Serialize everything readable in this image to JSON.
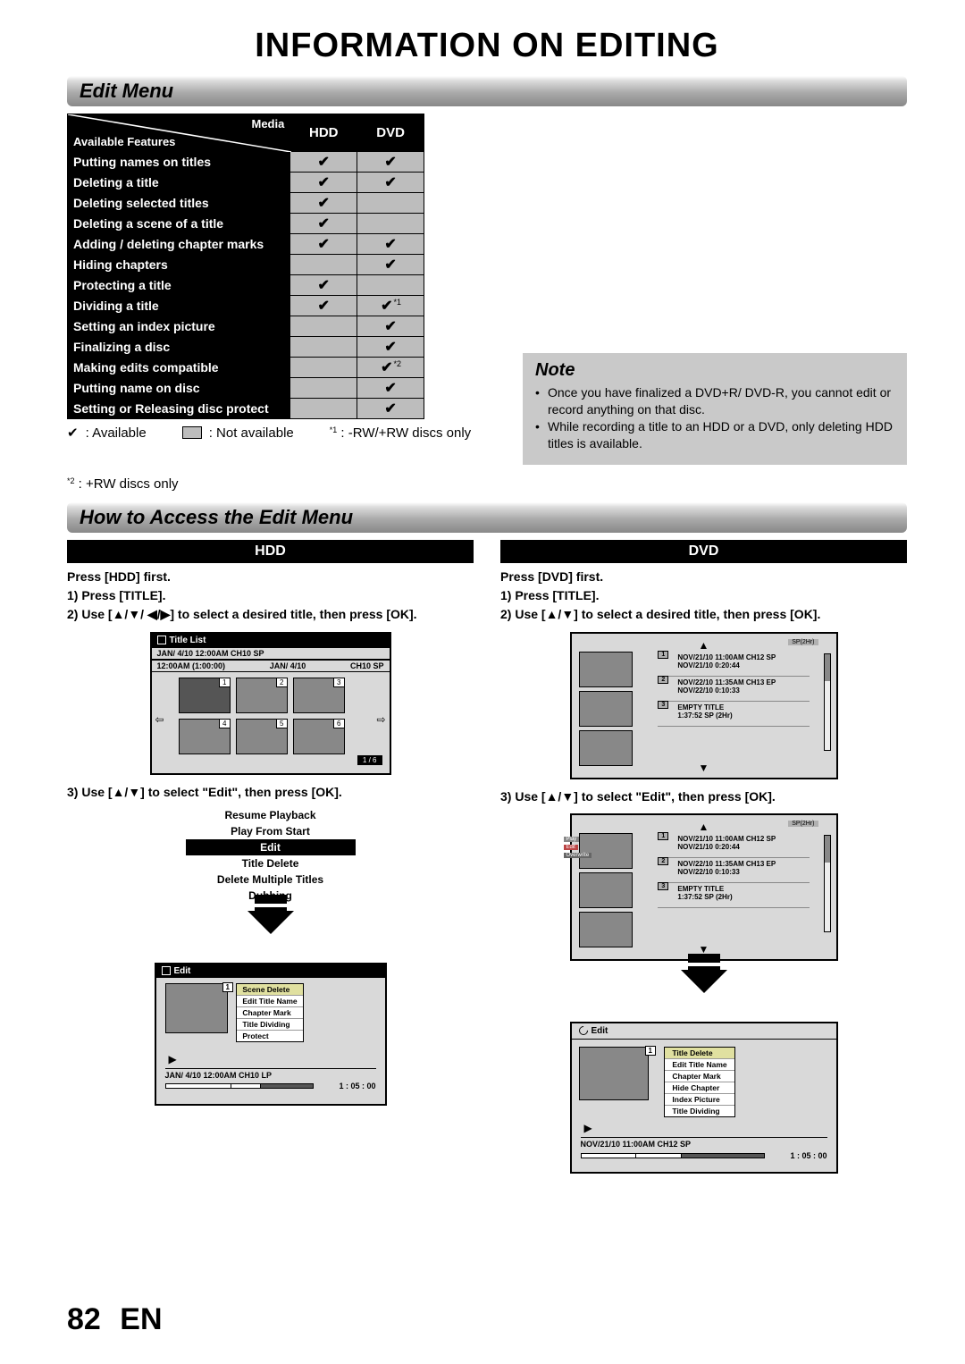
{
  "page": {
    "title": "INFORMATION ON EDITING",
    "number": "82",
    "lang": "EN"
  },
  "sections": {
    "edit_menu": "Edit Menu",
    "how_to": "How to Access the Edit Menu"
  },
  "features_table": {
    "corner_media": "Media",
    "corner_avail": "Available Features",
    "cols": [
      "HDD",
      "DVD"
    ],
    "rows": [
      {
        "label": "Putting names on titles",
        "hdd": "✔",
        "dvd": "✔"
      },
      {
        "label": "Deleting a title",
        "hdd": "✔",
        "dvd": "✔"
      },
      {
        "label": "Deleting selected titles",
        "hdd": "✔",
        "dvd": ""
      },
      {
        "label": "Deleting a scene of a title",
        "hdd": "✔",
        "dvd": ""
      },
      {
        "label": "Adding / deleting chapter marks",
        "hdd": "✔",
        "dvd": "✔"
      },
      {
        "label": "Hiding chapters",
        "hdd": "",
        "dvd": "✔"
      },
      {
        "label": "Protecting a title",
        "hdd": "✔",
        "dvd": ""
      },
      {
        "label": "Dividing a title",
        "hdd": "✔",
        "dvd": "✔",
        "dvd_sup": "*1"
      },
      {
        "label": "Setting an index picture",
        "hdd": "",
        "dvd": "✔"
      },
      {
        "label": "Finalizing a disc",
        "hdd": "",
        "dvd": "✔"
      },
      {
        "label": "Making edits compatible",
        "hdd": "",
        "dvd": "✔",
        "dvd_sup": "*2"
      },
      {
        "label": "Putting name on disc",
        "hdd": "",
        "dvd": "✔"
      },
      {
        "label": "Setting or Releasing disc protect",
        "hdd": "",
        "dvd": "✔"
      }
    ]
  },
  "legend": {
    "available": "✔",
    "available_label": ": Available",
    "na_label": ": Not available",
    "foot1_sup": "*1",
    "foot1": " : -RW/+RW discs only",
    "foot2_sup": "*2",
    "foot2": " : +RW discs only"
  },
  "note": {
    "title": "Note",
    "items": [
      "Once you have finalized a DVD+R/ DVD-R, you cannot edit or record anything on that disc.",
      "While recording a title to an HDD or a DVD, only deleting HDD titles is available."
    ]
  },
  "hdd": {
    "head": "HDD",
    "press_first": "Press [HDD] first.",
    "s1": "1) Press [TITLE].",
    "s2": "2) Use [▲/▼/ ◀/▶] to select a desired title, then press [OK].",
    "s3": "3) Use [▲/▼] to select \"Edit\", then press [OK].",
    "title_list": {
      "header": "Title List",
      "line1_left": "JAN/ 4/10 12:00AM CH10 SP",
      "line2_left": "12:00AM (1:00:00)",
      "line2_mid": "JAN/ 4/10",
      "line2_right": "CH10  SP",
      "pager": "1 / 6",
      "thumbs": [
        "1",
        "2",
        "3",
        "4",
        "5",
        "6"
      ]
    },
    "popup": {
      "items": [
        "Resume Playback",
        "Play From Start",
        "Edit",
        "Title Delete",
        "Delete Multiple Titles",
        "Dubbing"
      ],
      "selected": 2
    },
    "edit_screen": {
      "header": "Edit",
      "num": "1",
      "opts": [
        "Scene Delete",
        "Edit Title Name",
        "Chapter Mark",
        "Title Dividing",
        "Protect"
      ],
      "info": "JAN/ 4/10 12:00AM CH10  LP",
      "time": "1 : 05 : 00"
    }
  },
  "dvd": {
    "head": "DVD",
    "press_first": "Press [DVD] first.",
    "s1": "1) Press [TITLE].",
    "s2": "2) Use [▲/▼] to select a desired title, then press [OK].",
    "s3": "3) Use [▲/▼] to select \"Edit\", then press [OK].",
    "list_screen": {
      "sp": "SP(2Hr)",
      "slots": [
        {
          "n": "1",
          "l1": "NOV/21/10  11:00AM CH12 SP",
          "l2": "NOV/21/10  0:20:44"
        },
        {
          "n": "2",
          "l1": "NOV/22/10  11:35AM CH13 EP",
          "l2": "NOV/22/10  0:10:33"
        },
        {
          "n": "3",
          "l1": "EMPTY TITLE",
          "l2": "1:37:52 SP (2Hr)"
        }
      ]
    },
    "list_screen2": {
      "sp": "SP(2Hr)",
      "tags": [
        "Play",
        "Edit",
        "Overwrite"
      ],
      "slots": [
        {
          "n": "1",
          "l1": "NOV/21/10  11:00AM CH12 SP",
          "l2": "NOV/21/10  0:20:44"
        },
        {
          "n": "2",
          "l1": "NOV/22/10  11:35AM CH13 EP",
          "l2": "NOV/22/10  0:10:33"
        },
        {
          "n": "3",
          "l1": "EMPTY TITLE",
          "l2": "1:37:52 SP (2Hr)"
        }
      ]
    },
    "edit_screen": {
      "header": "Edit",
      "num": "1",
      "opts": [
        "Title Delete",
        "Edit Title Name",
        "Chapter Mark",
        "Hide Chapter",
        "Index Picture",
        "Title Dividing"
      ],
      "info": "NOV/21/10 11:00AM CH12 SP",
      "time": "1 : 05 : 00"
    }
  }
}
